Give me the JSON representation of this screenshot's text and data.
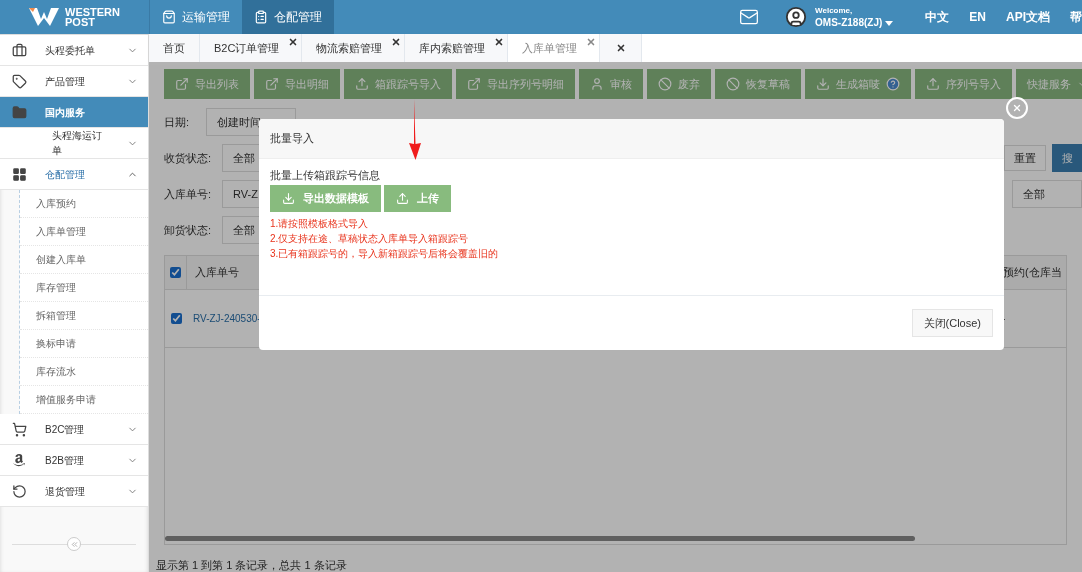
{
  "top_bar": {
    "logo": {
      "line_1": "WESTERN",
      "line_2": "POST"
    },
    "nav": [
      {
        "label": "运输管理",
        "selected": false
      },
      {
        "label": "仓配管理",
        "selected": true
      }
    ],
    "welcome": "Welcome,",
    "user": "OMS-Z188(ZJ)",
    "links": [
      "中文",
      "EN",
      "API文档",
      "帮"
    ]
  },
  "sidebar": {
    "items": [
      {
        "label": "头程委托单",
        "selected": false,
        "expanded": false
      },
      {
        "label": "产品管理",
        "selected": false,
        "expanded": false
      },
      {
        "label": "国内服务",
        "selected": true
      },
      {
        "label": "头程海运订单",
        "selected": false,
        "expanded": false,
        "kind": "sub"
      },
      {
        "label": "仓配管理",
        "selected": false,
        "expanded": true,
        "children": [
          {
            "label": "入库预约"
          },
          {
            "label": "入库单管理"
          },
          {
            "label": "创建入库单"
          },
          {
            "label": "库存管理"
          },
          {
            "label": "拆箱管理"
          },
          {
            "label": "换标申请"
          },
          {
            "label": "库存流水"
          },
          {
            "label": "增值服务申请"
          }
        ]
      },
      {
        "label": "B2C管理",
        "selected": false,
        "expanded": false
      },
      {
        "label": "B2B管理",
        "selected": false,
        "expanded": false
      },
      {
        "label": "退货管理",
        "selected": false,
        "expanded": false
      }
    ]
  },
  "tabs": [
    {
      "label": "首页",
      "selected": false,
      "closable": false
    },
    {
      "label": "B2C订单管理",
      "selected": false,
      "closable": true
    },
    {
      "label": "物流索赔管理",
      "selected": false,
      "closable": true
    },
    {
      "label": "库内索赔管理",
      "selected": false,
      "closable": true
    },
    {
      "label": "入库单管理",
      "selected": true,
      "closable": true
    }
  ],
  "toolbar": [
    {
      "label": "导出列表"
    },
    {
      "label": "导出明细"
    },
    {
      "label": "箱跟踪号导入"
    },
    {
      "label": "导出序列号明细"
    },
    {
      "label": "审核"
    },
    {
      "label": "废弃"
    },
    {
      "label": "恢复草稿"
    },
    {
      "label": "生成箱唛",
      "help": true
    },
    {
      "label": "序列号导入"
    },
    {
      "label": "快捷服务"
    }
  ],
  "filters": [
    {
      "label": "日期:",
      "value": "创建时间"
    },
    {
      "label": "收货状态:",
      "value": "全部"
    },
    {
      "label": "入库单号:",
      "value": "RV-Z"
    },
    {
      "label": "卸货状态:",
      "value": "全部"
    }
  ],
  "filter_actions": {
    "reset": "重置",
    "search": "搜",
    "select_value": "全部"
  },
  "table": {
    "columns": [
      "入库单号",
      "预约(仓库当"
    ],
    "rows": [
      {
        "checked": true,
        "cells": [
          "RV-ZJ-240530-",
          "-"
        ]
      }
    ],
    "header_checked": true
  },
  "status_bar": "显示第 1 到第 1 条记录，总共 1 条记录",
  "modal": {
    "title": "批量导入",
    "subtitle": "批量上传箱跟踪号信息",
    "buttons": [
      {
        "label": "导出数据模板",
        "kind": "download"
      },
      {
        "label": "上传",
        "kind": "upload"
      }
    ],
    "notes": [
      "1.请按照模板格式导入",
      "2.仅支持在途、草稿状态入库单导入箱跟踪号",
      "3.已有箱跟踪号的，导入新箱跟踪号后将会覆盖旧的"
    ],
    "close": "关闭(Close)"
  }
}
